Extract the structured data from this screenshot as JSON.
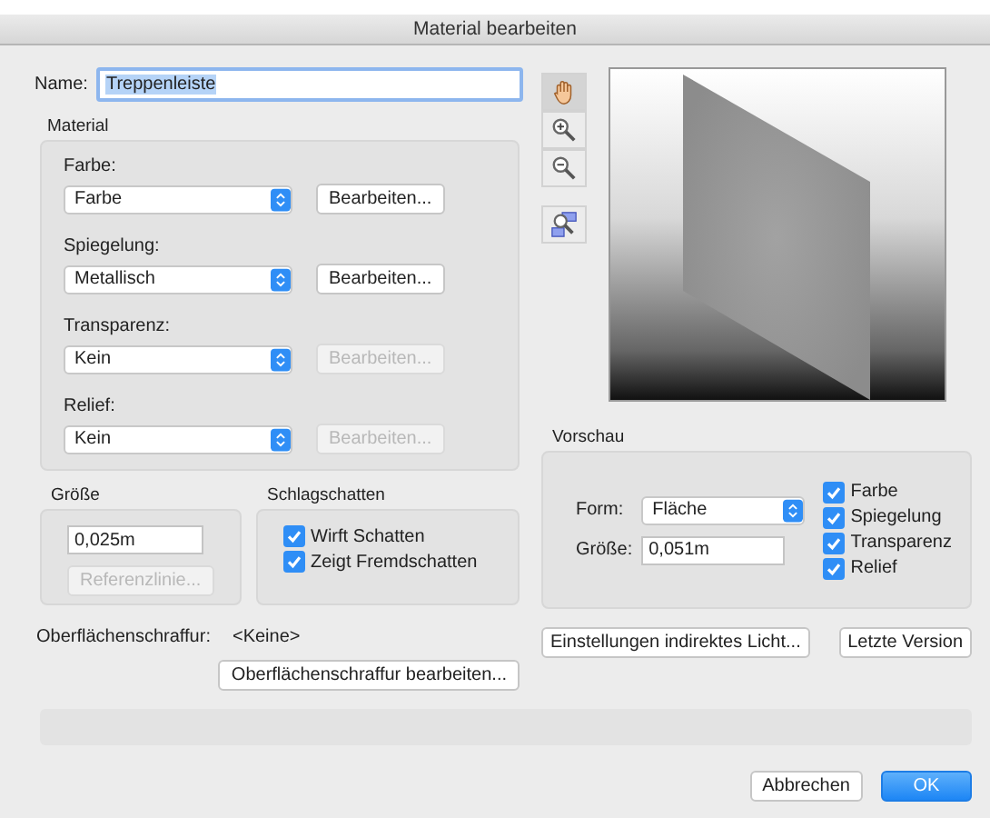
{
  "window": {
    "title": "Material bearbeiten"
  },
  "name": {
    "label": "Name:",
    "value": "Treppenleiste"
  },
  "material": {
    "title": "Material",
    "rows": [
      {
        "label": "Farbe:",
        "value": "Farbe",
        "button": {
          "label": "Bearbeiten...",
          "disabled": false
        }
      },
      {
        "label": "Spiegelung:",
        "value": "Metallisch",
        "button": {
          "label": "Bearbeiten...",
          "disabled": false
        }
      },
      {
        "label": "Transparenz:",
        "value": "Kein",
        "button": {
          "label": "Bearbeiten...",
          "disabled": true
        }
      },
      {
        "label": "Relief:",
        "value": "Kein",
        "button": {
          "label": "Bearbeiten...",
          "disabled": true
        }
      }
    ]
  },
  "size": {
    "title": "Größe",
    "value": "0,025m",
    "button": {
      "label": "Referenzlinie...",
      "disabled": true
    }
  },
  "shadow": {
    "title": "Schlagschatten",
    "checkboxes": [
      {
        "label": "Wirft Schatten",
        "checked": true
      },
      {
        "label": "Zeigt Fremdschatten",
        "checked": true
      }
    ]
  },
  "tools": [
    {
      "kind": "hand",
      "selected": true
    },
    {
      "kind": "zoom-in",
      "selected": false
    },
    {
      "kind": "zoom-out",
      "selected": false
    },
    {
      "kind": "zoom-region",
      "selected": false
    }
  ],
  "vorschau": {
    "title": "Vorschau",
    "form_label": "Form:",
    "form_value": "Fläche",
    "size_label": "Größe:",
    "size_value": "0,051m",
    "checkboxes": [
      {
        "label": "Farbe",
        "checked": true
      },
      {
        "label": "Spiegelung",
        "checked": true
      },
      {
        "label": "Transparenz",
        "checked": true
      },
      {
        "label": "Relief",
        "checked": true
      }
    ]
  },
  "hatch": {
    "label": "Oberflächenschraffur:",
    "value": "<Keine>",
    "button": "Oberflächenschraffur bearbeiten..."
  },
  "light_button": "Einstellungen indirektes Licht...",
  "version_button": "Letzte Version",
  "footer": [
    {
      "label": "Abbrechen",
      "default": false
    },
    {
      "label": "OK",
      "default": true
    }
  ]
}
